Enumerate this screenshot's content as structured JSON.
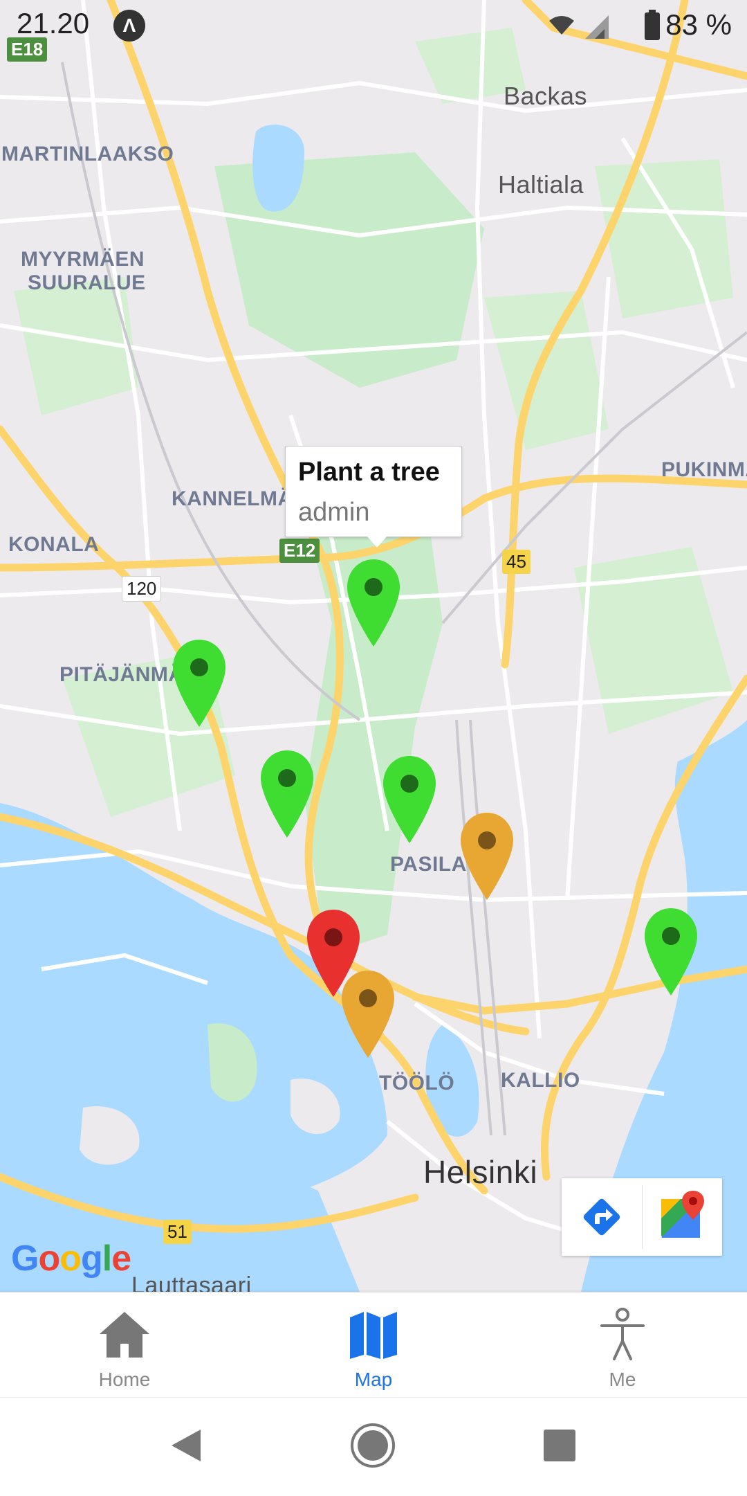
{
  "status_bar": {
    "time": "21.20",
    "battery": "83 %",
    "nav_icon": "navigation-arrow-icon"
  },
  "map": {
    "labels": {
      "backas": "Backas",
      "haltiala": "Haltiala",
      "martinlaakso": "MARTINLAAKSO",
      "myyrmaen_line1": "MYYRMÄEN",
      "myyrmaen_line2": "SUURALUE",
      "pukinmaki": "PUKINMÄ",
      "kannelmaki": "KANNELMÄ",
      "konala": "KONALA",
      "pitajanmaki": "PITÄJÄNMÄ",
      "pasila": "PASILA",
      "toolo": "TÖÖLÖ",
      "kallio": "KALLIO",
      "helsinki": "Helsinki",
      "lauttasaari": "Lauttasaari"
    },
    "road_shields": {
      "e18": "E18",
      "e12": "E12",
      "r120": "120",
      "r45": "45",
      "r51": "51"
    },
    "popup": {
      "title": "Plant a tree",
      "subtitle": "admin"
    },
    "markers": [
      {
        "status": "green",
        "color": "#3fdc32"
      },
      {
        "status": "green",
        "color": "#3fdc32"
      },
      {
        "status": "green",
        "color": "#3fdc32"
      },
      {
        "status": "green",
        "color": "#3fdc32"
      },
      {
        "status": "orange",
        "color": "#e8a732"
      },
      {
        "status": "red",
        "color": "#e8302f"
      },
      {
        "status": "orange",
        "color": "#e8a732"
      },
      {
        "status": "green",
        "color": "#3fdc32"
      }
    ],
    "attribution": "Google",
    "tools": {
      "directions_icon": "directions-icon",
      "open_in_maps_icon": "google-maps-icon"
    }
  },
  "tabs": [
    {
      "label": "Home",
      "icon": "home-icon",
      "active": false
    },
    {
      "label": "Map",
      "icon": "map-icon",
      "active": true
    },
    {
      "label": "Me",
      "icon": "person-icon",
      "active": false
    }
  ],
  "colors": {
    "accent": "#1a73e8",
    "inactive": "#888888",
    "water": "#aadaff",
    "park": "#c8ebc9",
    "road": "#fdd46b"
  }
}
